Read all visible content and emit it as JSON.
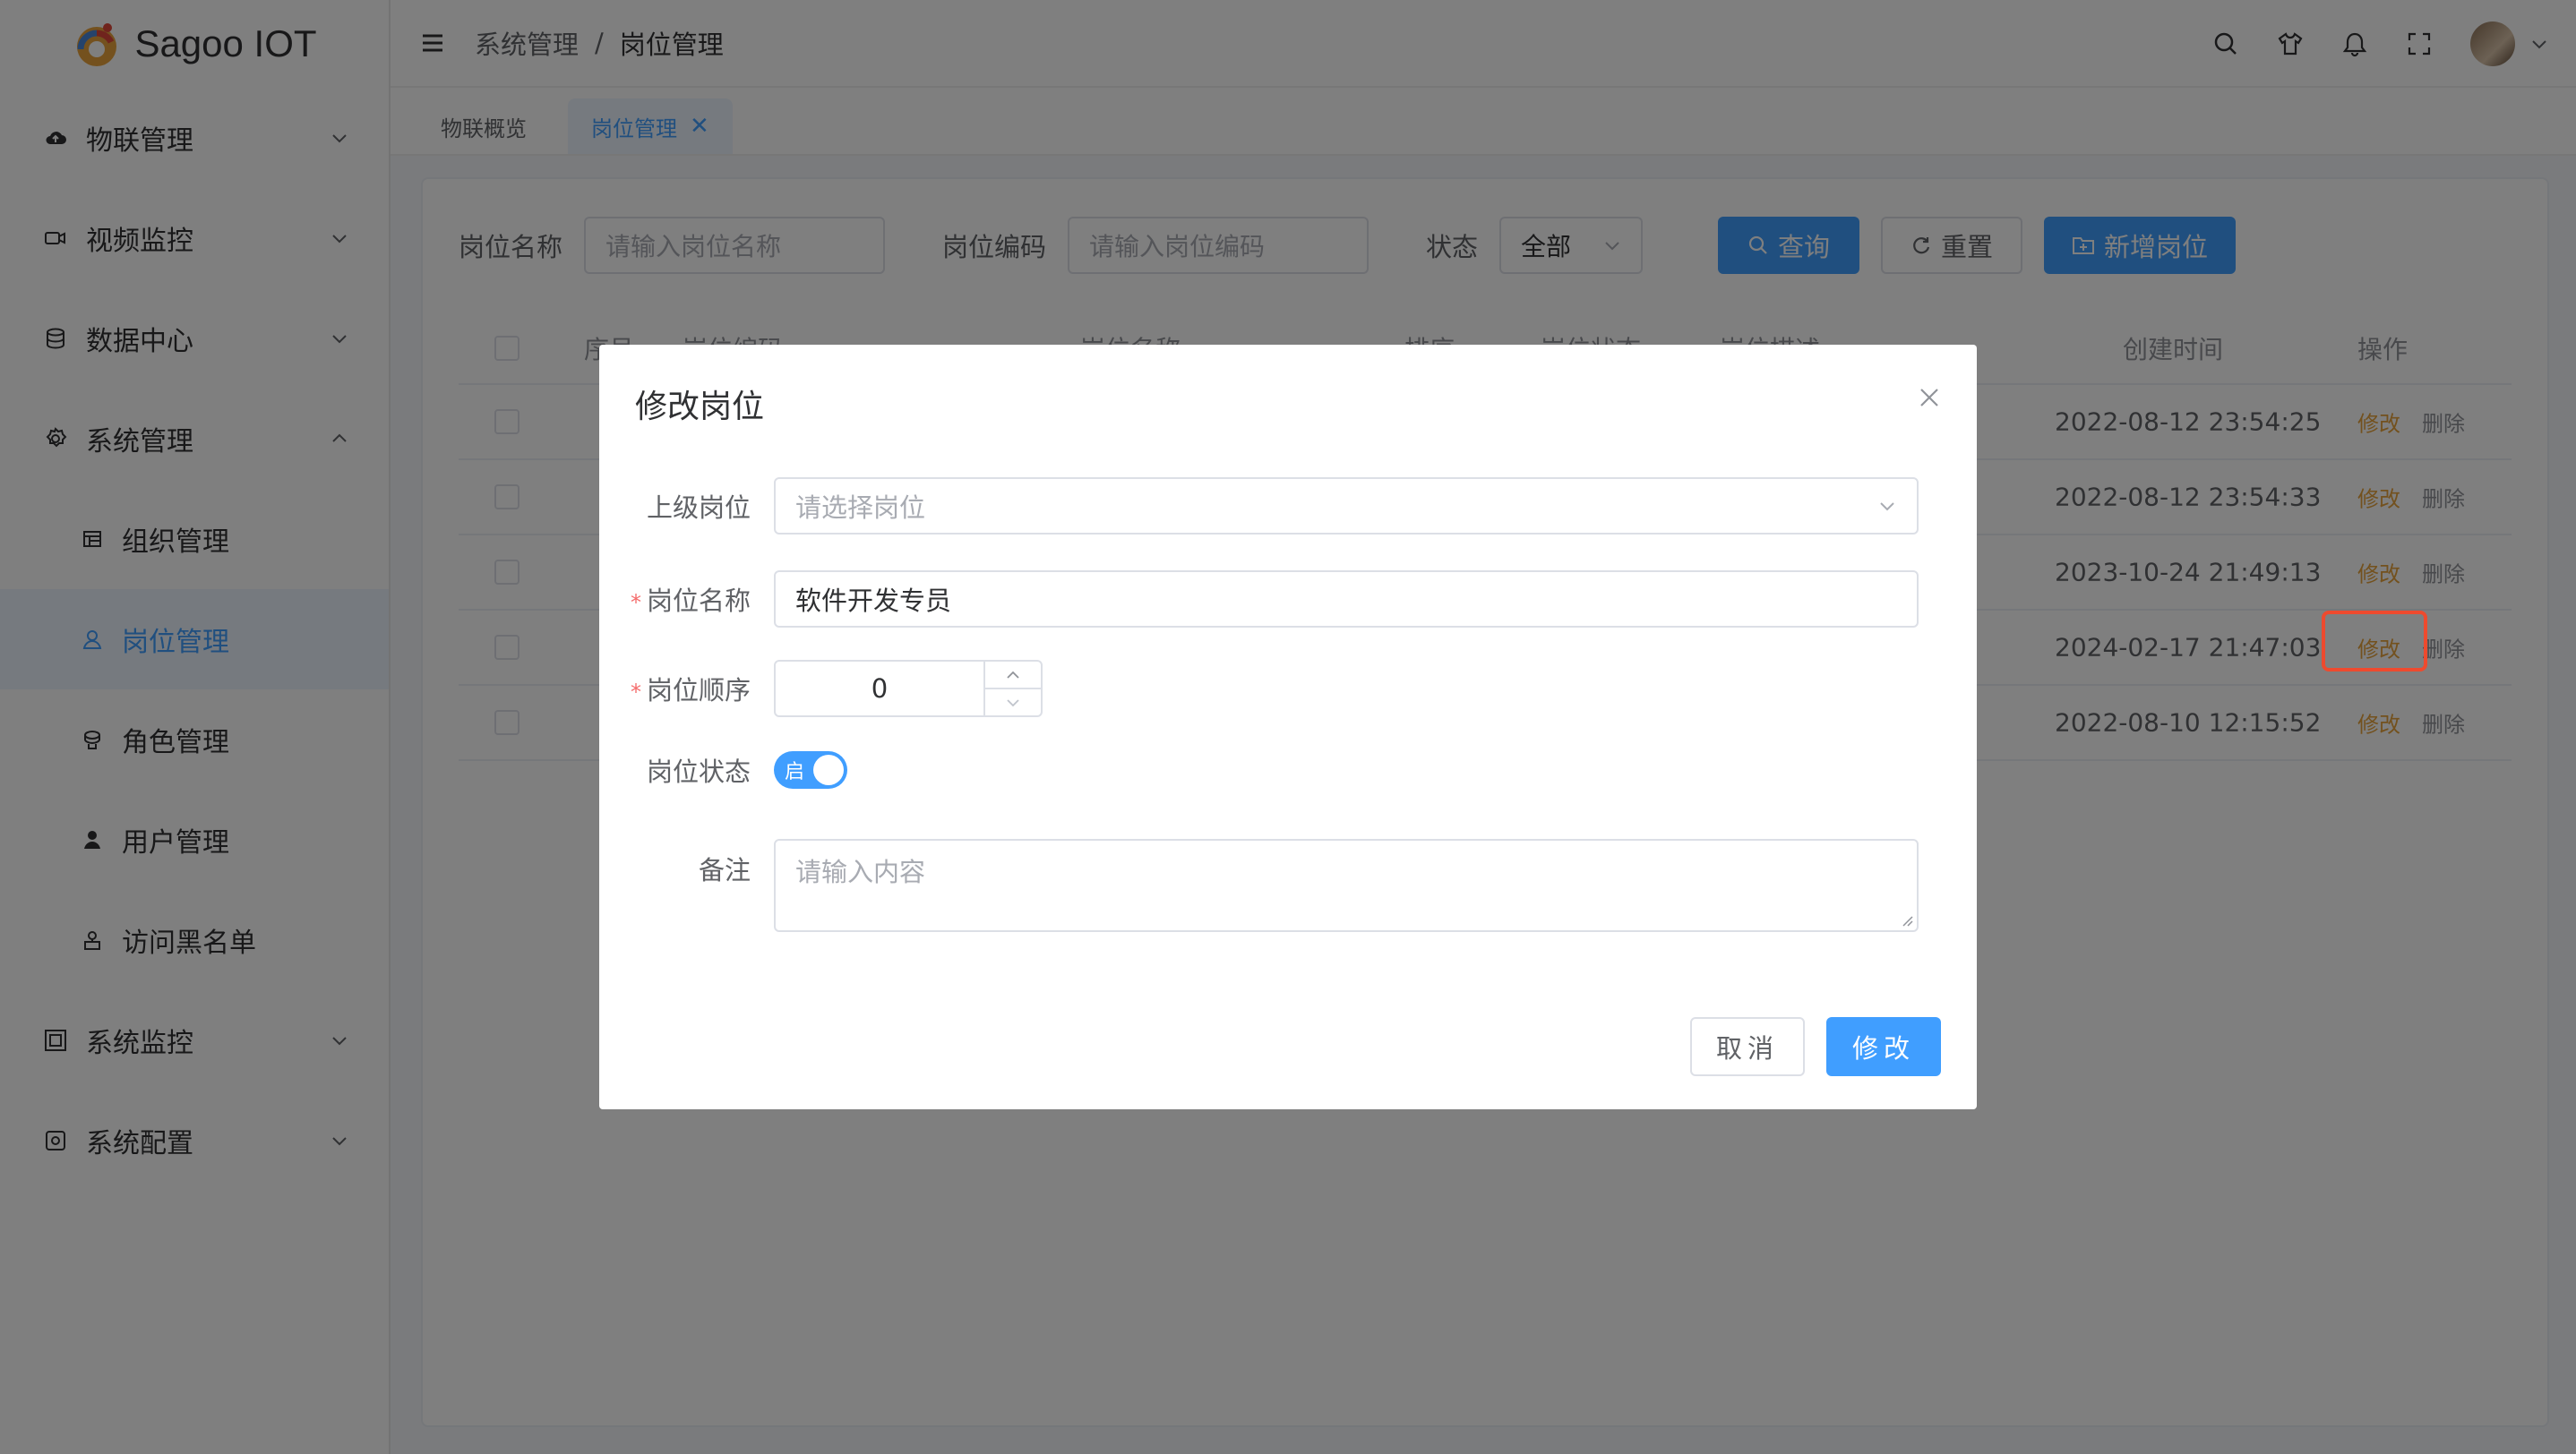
{
  "app": {
    "name": "Sagoo IOT"
  },
  "sidebar": {
    "items": [
      {
        "label": "物联管理",
        "icon": "cloud-icon",
        "expanded": false
      },
      {
        "label": "视频监控",
        "icon": "video-icon",
        "expanded": false
      },
      {
        "label": "数据中心",
        "icon": "database-icon",
        "expanded": false
      },
      {
        "label": "系统管理",
        "icon": "gear-icon",
        "expanded": true
      },
      {
        "label": "系统监控",
        "icon": "monitor-icon",
        "expanded": false
      },
      {
        "label": "系统配置",
        "icon": "config-icon",
        "expanded": false
      }
    ],
    "sub_items": [
      {
        "label": "组织管理",
        "icon": "org-icon",
        "active": false
      },
      {
        "label": "岗位管理",
        "icon": "user-outline-icon",
        "active": true
      },
      {
        "label": "角色管理",
        "icon": "role-icon",
        "active": false
      },
      {
        "label": "用户管理",
        "icon": "user-icon",
        "active": false
      },
      {
        "label": "访问黑名单",
        "icon": "blacklist-icon",
        "active": false
      }
    ]
  },
  "header": {
    "breadcrumb": [
      "系统管理",
      "岗位管理"
    ],
    "separator": "/"
  },
  "tabs": [
    {
      "label": "物联概览",
      "active": false
    },
    {
      "label": "岗位管理",
      "active": true,
      "close": "✕"
    }
  ],
  "filter": {
    "name_label": "岗位名称",
    "name_placeholder": "请输入岗位名称",
    "code_label": "岗位编码",
    "code_placeholder": "请输入岗位编码",
    "status_label": "状态",
    "status_value": "全部",
    "query_button": "查询",
    "reset_button": "重置",
    "add_button": "新增岗位"
  },
  "table": {
    "columns": [
      "序号",
      "岗位编码",
      "岗位名称",
      "排序",
      "岗位状态",
      "岗位描述",
      "创建时间",
      "操作"
    ],
    "rows": [
      {
        "created": "2022-08-12 23:54:25",
        "edit": "修改",
        "delete": "删除"
      },
      {
        "created": "2022-08-12 23:54:33",
        "edit": "修改",
        "delete": "删除"
      },
      {
        "created": "2023-10-24 21:49:13",
        "edit": "修改",
        "delete": "删除"
      },
      {
        "created": "2024-02-17 21:47:03",
        "edit": "修改",
        "delete": "删除"
      },
      {
        "created": "2022-08-10 12:15:52",
        "edit": "修改",
        "delete": "删除"
      }
    ]
  },
  "dialog": {
    "title": "修改岗位",
    "parent_label": "上级岗位",
    "parent_placeholder": "请选择岗位",
    "name_label": "岗位名称",
    "name_value": "软件开发专员",
    "order_label": "岗位顺序",
    "order_value": "0",
    "status_label": "岗位状态",
    "status_switch_text": "启",
    "remark_label": "备注",
    "remark_placeholder": "请输入内容",
    "required_mark": "*",
    "cancel_button": "取消",
    "submit_button": "修改"
  },
  "colors": {
    "primary": "#409eff",
    "edit_link": "#e6a23c",
    "highlight": "#ee4a2e",
    "required": "#f56c6c"
  }
}
